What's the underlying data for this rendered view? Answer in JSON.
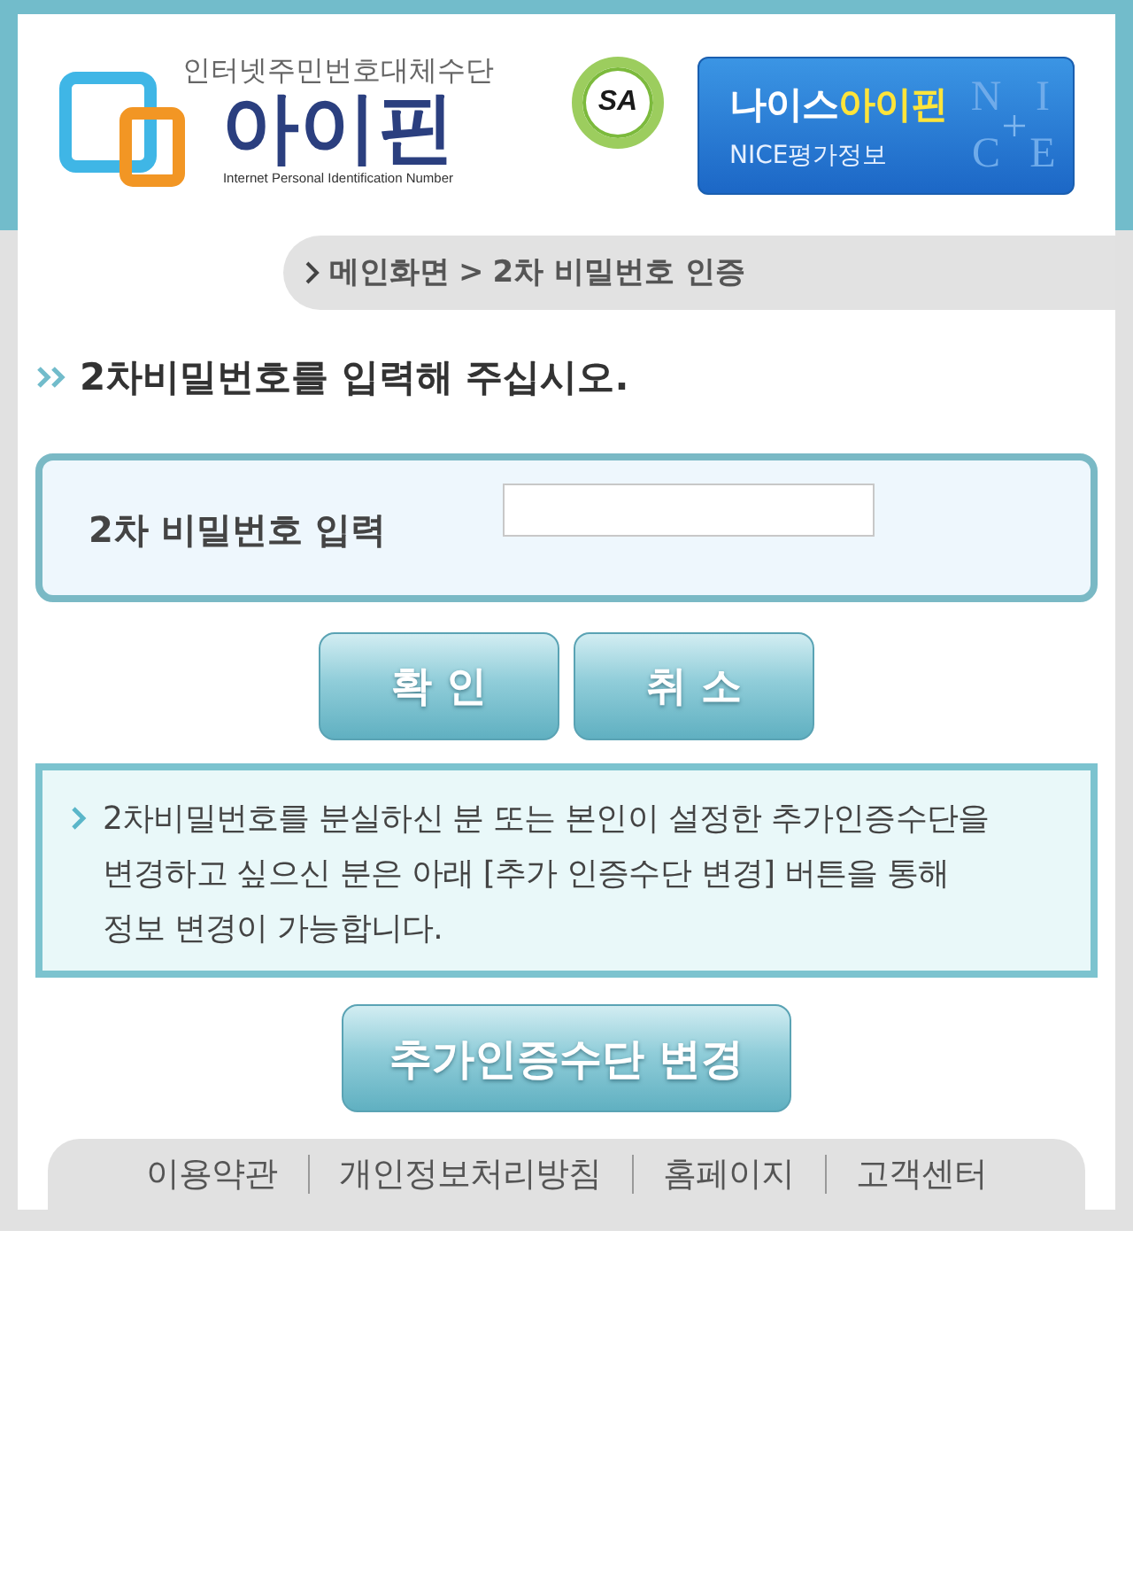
{
  "header": {
    "logo": {
      "tagline": "인터넷주민번호대체수단",
      "name": "아이핀",
      "subtitle": "Internet Personal Identification Number"
    },
    "badge": {
      "label": "SA"
    },
    "banner": {
      "title": [
        {
          "text": "나이스",
          "highlight": false
        },
        {
          "text": "아이핀",
          "highlight": true
        }
      ],
      "subtitle": "NICE평가정보",
      "letters": [
        "N",
        "I",
        "C",
        "E"
      ]
    }
  },
  "breadcrumb": {
    "items": [
      "메인화면",
      "2차 비밀번호 인증"
    ],
    "separator": ">"
  },
  "heading": "2차비밀번호를 입력해 주십시오.",
  "password_form": {
    "label": "2차 비밀번호 입력"
  },
  "buttons": [
    {
      "label": "확 인"
    },
    {
      "label": "취 소"
    }
  ],
  "notice": "2차비밀번호를 분실하신 분 또는 본인이 설정한 추가인증수단을\n변경하고 싶으신 분은 아래 [추가 인증수단 변경] 버튼을 통해\n정보 변경이 가능합니다.",
  "change_button": {
    "label": "추가인증수단 변경"
  },
  "footer": {
    "links": [
      "이용약관",
      "개인정보처리방침",
      "홈페이지",
      "고객센터"
    ]
  }
}
